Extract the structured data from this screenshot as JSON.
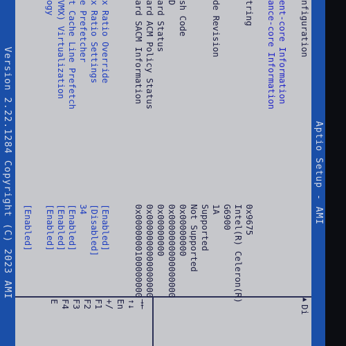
{
  "header": {
    "title": "Aptio Setup - AMI"
  },
  "footer": {
    "version": "Version 2.22.1284 Copyright (C) 2023 AMI"
  },
  "rows": [
    {
      "label": "nfiguration",
      "value": "",
      "kind": "plain"
    },
    {
      "label": "",
      "value": "",
      "kind": "plain"
    },
    {
      "label": "ent-core Information",
      "value": "",
      "kind": "section"
    },
    {
      "label": "ance-core Information",
      "value": "",
      "kind": "section"
    },
    {
      "label": "",
      "value": "",
      "kind": "plain"
    },
    {
      "label": "tring",
      "value": "0x9675",
      "kind": "plain"
    },
    {
      "label": "",
      "value": "Intel(R) Celeron(R)",
      "kind": "plain"
    },
    {
      "label": "",
      "value": "G6900",
      "kind": "plain"
    },
    {
      "label": "de Revision",
      "value": "1A",
      "kind": "plain"
    },
    {
      "label": "",
      "value": "Supported",
      "kind": "plain"
    },
    {
      "label": "",
      "value": "Not Supported",
      "kind": "plain"
    },
    {
      "label": "sh Code",
      "value": "0x00000000",
      "kind": "plain"
    },
    {
      "label": "D",
      "value": "0x0000000000000000",
      "kind": "plain"
    },
    {
      "label": "ard Status",
      "value": "0x00000000",
      "kind": "plain"
    },
    {
      "label": "ard ACM Policy Status",
      "value": "0x0000000000000000",
      "kind": "plain"
    },
    {
      "label": "ard SACM Information",
      "value": "0x0000000100000000",
      "kind": "plain"
    },
    {
      "label": "",
      "value": "",
      "kind": "plain"
    },
    {
      "label": "",
      "value": "",
      "kind": "plain"
    },
    {
      "label": "x Ratio Override",
      "value": "[Enabled]",
      "kind": "opt"
    },
    {
      "label": "x Ratio Settings",
      "value": "[Disabled]",
      "kind": "opt"
    },
    {
      "label": "e Prefetcher",
      "value": "34",
      "kind": "opt"
    },
    {
      "label": "t Cache Line Prefetch",
      "value": "[Enabled]",
      "kind": "opt"
    },
    {
      "label": "VMX) Virtualization",
      "value": "[Enabled]",
      "kind": "opt"
    },
    {
      "label": "ogy",
      "value": "[Enabled]",
      "kind": "opt"
    },
    {
      "label": "",
      "value": "",
      "kind": "plain"
    },
    {
      "label": "",
      "value": "[Enabled]",
      "kind": "opt"
    }
  ],
  "help": {
    "title": "Di",
    "keys": [
      "→←",
      "↑↓",
      "En",
      "+/",
      "F1",
      "F2",
      "F3",
      "F4",
      "E"
    ]
  }
}
